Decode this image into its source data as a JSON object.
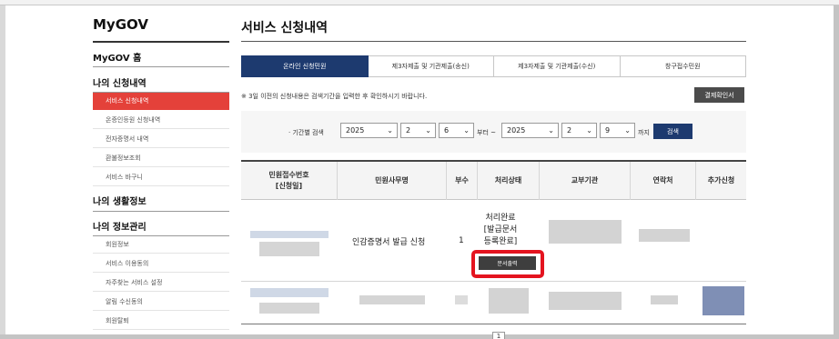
{
  "sidebar": {
    "brand": "MyGOV",
    "home": "MyGOV 홈",
    "section1": "나의 신청내역",
    "sub1": [
      "서비스 신청내역",
      "온증인등원 신청내역",
      "전자증명서 내역",
      "환불정보조회",
      "서비스 바구니"
    ],
    "section2": "나의 생활정보",
    "section3": "나의 정보관리",
    "sub3": [
      "회원정보",
      "서비스 이용동의",
      "자주찾는 서비스 설정",
      "알림 수신동의",
      "회원탈퇴"
    ]
  },
  "main": {
    "title": "서비스 신청내역",
    "tabs": [
      "온라인 신청민원",
      "제3자제출 및 기관제출(송신)",
      "제3자제출 및 기관제출(수신)",
      "창구접수민원"
    ],
    "note": "※ 3일 이전의 신청내용은 검색기간을 입력한 후 확인하시기 바랍니다.",
    "confirm_button": "결제확인서"
  },
  "filter": {
    "label": "· 기간별 검색",
    "from_year": "2025",
    "from_month": "2",
    "from_day": "6",
    "from_suffix": "부터 ~",
    "to_year": "2025",
    "to_month": "2",
    "to_day": "9",
    "to_suffix": "까지",
    "search_button": "검색"
  },
  "table": {
    "headers": [
      "민원접수번호\n[신청일]",
      "민원사무명",
      "부수",
      "처리상태",
      "교부기관",
      "연락처",
      "추가신청"
    ],
    "row1": {
      "service": "인감증명서 발급 신청",
      "copies": "1",
      "status": "처리완료\n[발급문서\n등록완료]",
      "print_button": "문서출력"
    }
  },
  "pager": {
    "current": "1"
  },
  "colors": {
    "accent_red": "#e4413a",
    "navy": "#1d3a6f",
    "highlight": "#e4141f"
  }
}
